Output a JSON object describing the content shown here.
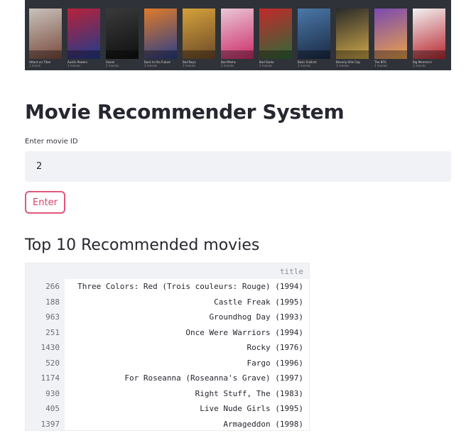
{
  "banner": {
    "posters": [
      {
        "caption": "Attack on Titan",
        "sub": "1 movie",
        "colors": [
          "#c9c2bd",
          "#7a4b3c"
        ]
      },
      {
        "caption": "Austin Powers",
        "sub": "3 movies",
        "colors": [
          "#b7223a",
          "#1f3c8c"
        ]
      },
      {
        "caption": "Azumi",
        "sub": "2 movies",
        "colors": [
          "#3a3a3a",
          "#101010"
        ]
      },
      {
        "caption": "Back to the Future",
        "sub": "3 movies",
        "colors": [
          "#e07b2a",
          "#2a3e88"
        ]
      },
      {
        "caption": "Bad Boys",
        "sub": "3 movies",
        "colors": [
          "#d6a13a",
          "#6b4a2a"
        ]
      },
      {
        "caption": "Bad Moms",
        "sub": "2 movies",
        "colors": [
          "#e9c7d6",
          "#cc2b68"
        ]
      },
      {
        "caption": "Bad Santa",
        "sub": "2 movies",
        "colors": [
          "#c22a2a",
          "#2d6a3a"
        ]
      },
      {
        "caption": "Basic Instinct",
        "sub": "2 movies",
        "colors": [
          "#4a78a8",
          "#1b2a44"
        ]
      },
      {
        "caption": "Beverly Hills Cop",
        "sub": "3 movies",
        "colors": [
          "#2a2a2a",
          "#cfa84a"
        ]
      },
      {
        "caption": "The BFG",
        "sub": "2 movies",
        "colors": [
          "#7a4ab0",
          "#e8a24a"
        ]
      },
      {
        "caption": "Big Momma's",
        "sub": "3 movies",
        "colors": [
          "#f2f2f2",
          "#b8262f"
        ]
      }
    ]
  },
  "title": "Movie Recommender System",
  "input": {
    "label": "Enter movie ID",
    "value": "2"
  },
  "button": {
    "label": "Enter"
  },
  "section_title": "Top 10 Recommended movies",
  "table": {
    "column": "title",
    "rows": [
      {
        "id": "266",
        "title": "Three Colors: Red (Trois couleurs: Rouge) (1994)"
      },
      {
        "id": "188",
        "title": "Castle Freak (1995)"
      },
      {
        "id": "963",
        "title": "Groundhog Day (1993)"
      },
      {
        "id": "251",
        "title": "Once Were Warriors (1994)"
      },
      {
        "id": "1430",
        "title": "Rocky (1976)"
      },
      {
        "id": "520",
        "title": "Fargo (1996)"
      },
      {
        "id": "1174",
        "title": "For Roseanna (Roseanna's Grave) (1997)"
      },
      {
        "id": "930",
        "title": "Right Stuff, The (1983)"
      },
      {
        "id": "405",
        "title": "Live Nude Girls (1995)"
      },
      {
        "id": "1397",
        "title": "Armageddon (1998)"
      }
    ]
  }
}
